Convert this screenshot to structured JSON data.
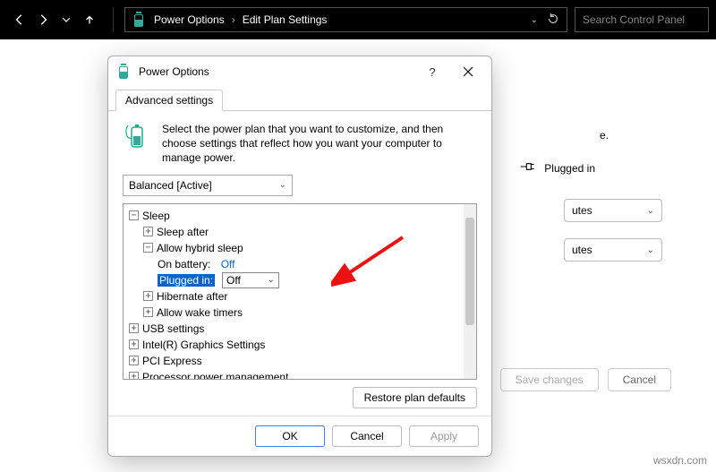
{
  "topbar": {
    "breadcrumb": [
      "Power Options",
      "Edit Plan Settings"
    ],
    "search_placeholder": "Search Control Panel"
  },
  "background": {
    "suffix_text": "e.",
    "plugged_in_label": "Plugged in",
    "dropdown_suffix": "utes",
    "save_label": "Save changes",
    "cancel_label": "Cancel"
  },
  "dialog": {
    "title": "Power Options",
    "tab_label": "Advanced settings",
    "intro_text": "Select the power plan that you want to customize, and then choose settings that reflect how you want your computer to manage power.",
    "plan_selected": "Balanced [Active]",
    "tree": {
      "sleep": "Sleep",
      "sleep_after": "Sleep after",
      "allow_hybrid": "Allow hybrid sleep",
      "on_battery_label": "On battery:",
      "on_battery_value": "Off",
      "plugged_in_label": "Plugged in:",
      "plugged_in_value": "Off",
      "hibernate_after": "Hibernate after",
      "allow_wake": "Allow wake timers",
      "usb": "USB settings",
      "intel": "Intel(R) Graphics Settings",
      "pci": "PCI Express",
      "processor": "Processor power management"
    },
    "restore_label": "Restore plan defaults",
    "ok_label": "OK",
    "cancel_label": "Cancel",
    "apply_label": "Apply"
  },
  "watermark": "wsxdn.com"
}
